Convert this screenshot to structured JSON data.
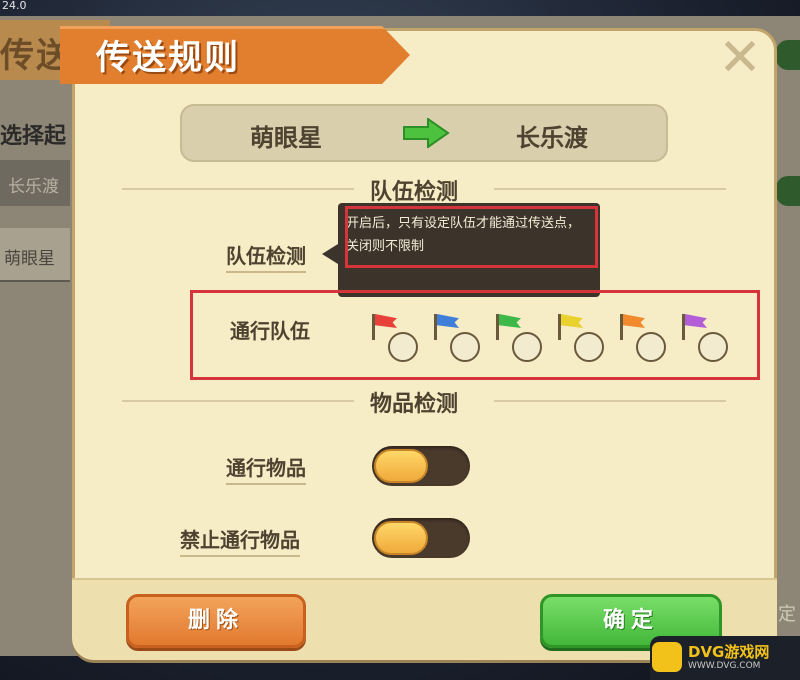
{
  "background": {
    "version": "24.0",
    "title_fragment": "传送点",
    "label_fragment": "选择起",
    "field1_fragment": "长乐渡",
    "field2_fragment": "萌眼星",
    "right_fragment": "定"
  },
  "dialog": {
    "title": "传送规则",
    "close_icon": "close-icon"
  },
  "route": {
    "from": "萌眼星",
    "to": "长乐渡",
    "arrow_color": "#4cc23f"
  },
  "team_section": {
    "title": "队伍检测",
    "team_check_label": "队伍检测",
    "tooltip": "开启后，只有设定队伍才能通过传送点，关闭则不限制",
    "pass_team_label": "通行队伍",
    "flags": [
      {
        "color": "#e8413a",
        "checked": false
      },
      {
        "color": "#3f7fd9",
        "checked": false
      },
      {
        "color": "#3fb84a",
        "checked": false
      },
      {
        "color": "#e9d22e",
        "checked": false
      },
      {
        "color": "#f08a2c",
        "checked": false
      },
      {
        "color": "#b35ed6",
        "checked": false
      }
    ]
  },
  "item_section": {
    "title": "物品检测",
    "pass_item_label": "通行物品",
    "pass_item_enabled": false,
    "forbid_item_label": "禁止通行物品",
    "forbid_item_enabled": false
  },
  "footer": {
    "delete_label": "删除",
    "confirm_label": "确定"
  },
  "watermark": {
    "name": "DVG游戏网",
    "url": "WWW.DVG.COM"
  },
  "colors": {
    "dialog_bg": "#f6ecc6",
    "title_banner": "#e27f2f",
    "highlight_red": "#d4343a",
    "delete_button": "#e8873a",
    "confirm_button": "#4cc23f"
  }
}
